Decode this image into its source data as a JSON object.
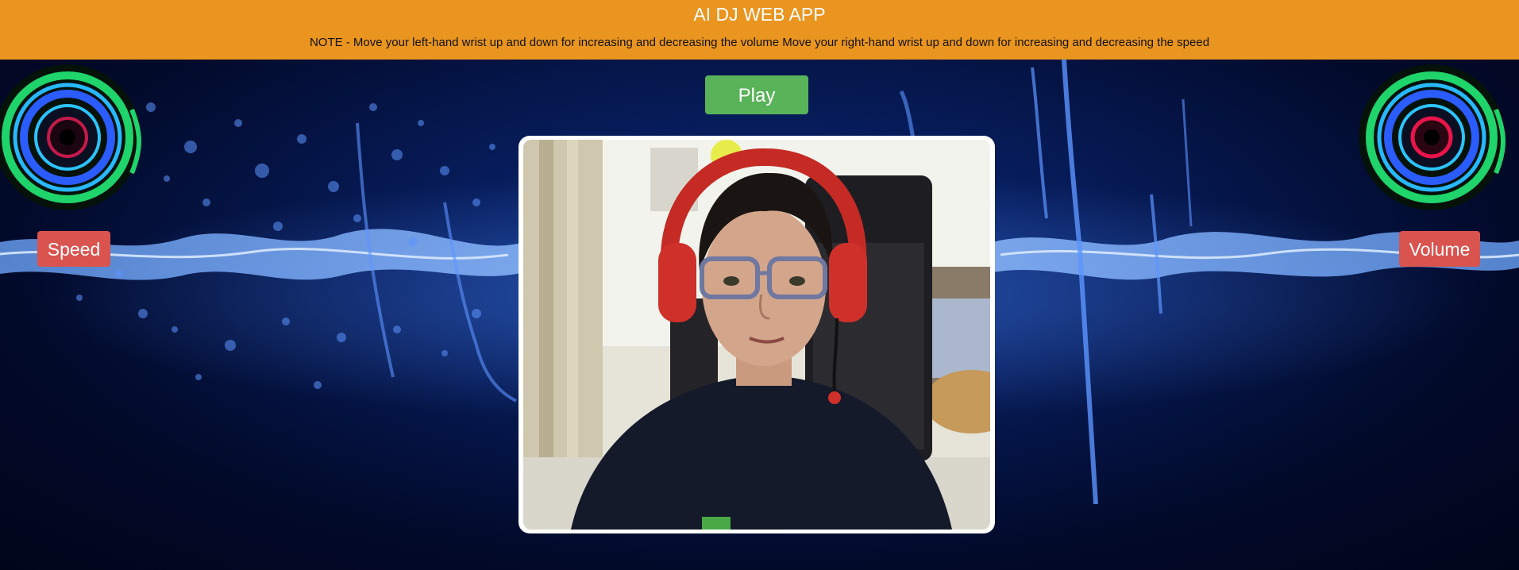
{
  "header": {
    "title": "AI DJ WEB APP",
    "note": "NOTE - Move your left-hand wrist up and down for increasing and decreasing the volume Move your right-hand wrist up and down for increasing and decreasing the speed"
  },
  "controls": {
    "play_label": "Play",
    "speed_label": "Speed",
    "volume_label": "Volume"
  },
  "video": {
    "icon": "webcam-feed"
  },
  "colors": {
    "header_bg": "#ea9520",
    "play_button": "#59b359",
    "side_buttons": "#d9534f",
    "background": "#061a55"
  }
}
